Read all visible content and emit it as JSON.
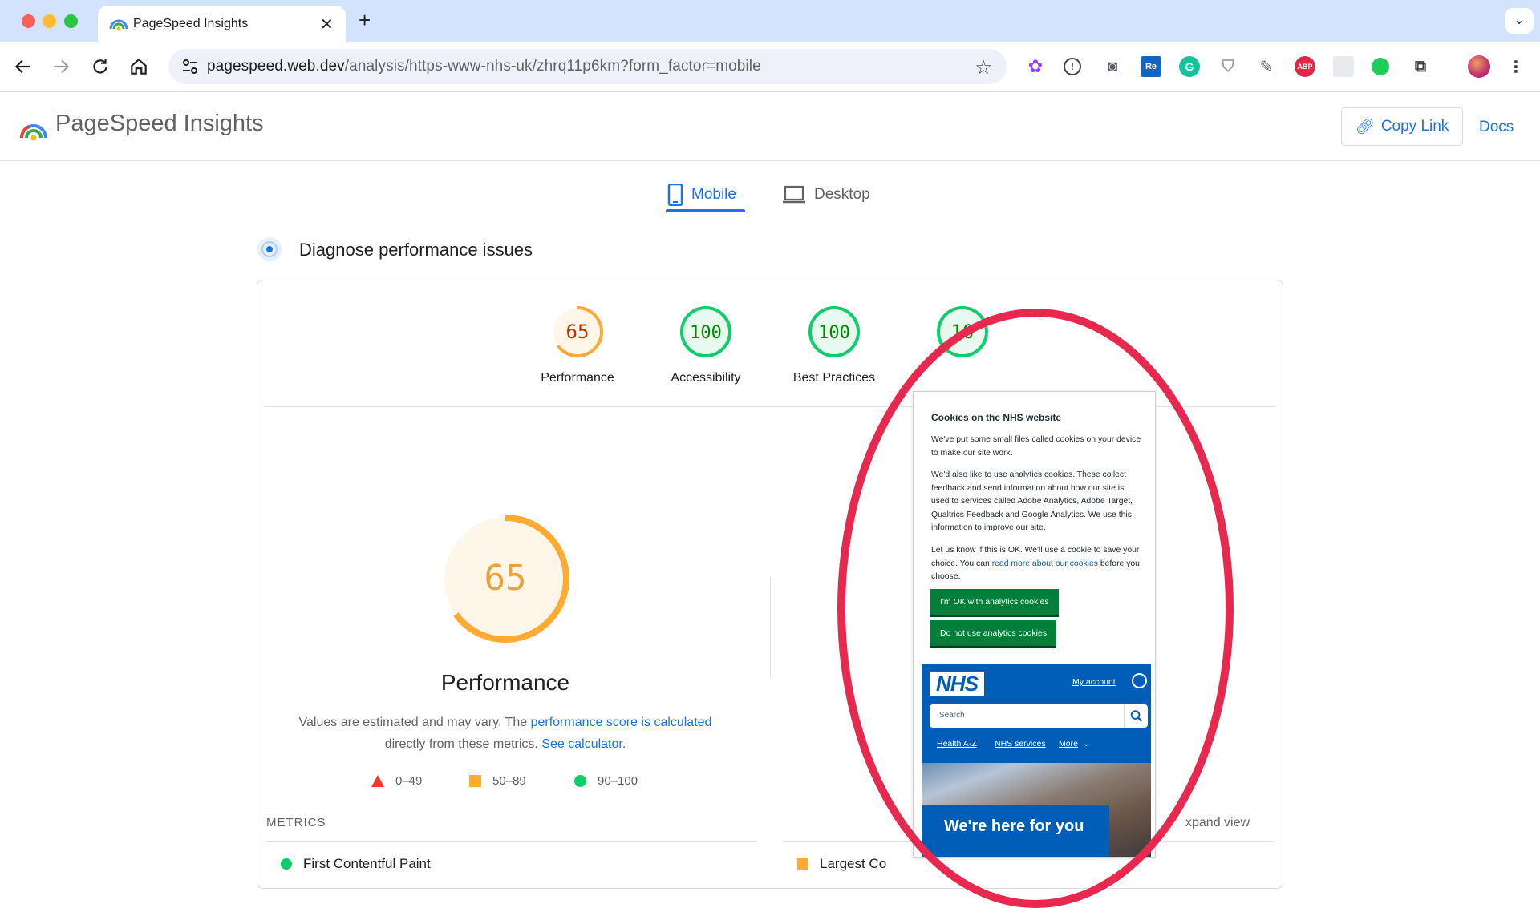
{
  "browser": {
    "tab_title": "PageSpeed Insights",
    "url_host": "pagespeed.web.dev",
    "url_path": "/analysis/https-www-nhs-uk/zhrq11p6km?form_factor=mobile",
    "extensions": [
      "puzzle-flower-icon",
      "info-icon",
      "camera-icon",
      "re-icon",
      "grammarly-icon",
      "shield-icon",
      "pin-icon",
      "abp-icon",
      "grid-icon",
      "green-dot-icon",
      "extensions-icon"
    ],
    "ext_labels": {
      "re": "Re",
      "abp": "ABP"
    }
  },
  "header": {
    "title": "PageSpeed Insights",
    "copy_link": "Copy Link",
    "docs": "Docs"
  },
  "device_tabs": {
    "mobile": "Mobile",
    "desktop": "Desktop"
  },
  "diagnose": {
    "title": "Diagnose performance issues"
  },
  "scores": [
    {
      "label": "Performance",
      "value": "65",
      "color": "#ffaa33",
      "text_color": "#c33300",
      "fraction": 0.65
    },
    {
      "label": "Accessibility",
      "value": "100",
      "color": "#0cce6b",
      "text_color": "#008800",
      "fraction": 1.0
    },
    {
      "label": "Best Practices",
      "value": "100",
      "color": "#0cce6b",
      "text_color": "#008800",
      "fraction": 1.0
    },
    {
      "label": "",
      "value": "10",
      "color": "#0cce6b",
      "text_color": "#008800",
      "fraction": 1.0
    }
  ],
  "performance": {
    "score": "65",
    "fraction": 0.65,
    "heading": "Performance",
    "desc_1": "Values are estimated and may vary. The ",
    "desc_link_1": "performance score is calculated",
    "desc_2": "directly from these metrics. ",
    "desc_link_2": "See calculator."
  },
  "legend": {
    "fail": "0–49",
    "average": "50–89",
    "pass": "90–100"
  },
  "metrics": {
    "label": "METRICS",
    "expand": "xpand view",
    "fcp": "First Contentful Paint",
    "lcp": "Largest Co"
  },
  "phone": {
    "cookie_title": "Cookies on the NHS website",
    "p1": "We've put some small files called cookies on your device to make our site work.",
    "p2": "We'd also like to use analytics cookies. These collect feedback and send information about how our site is used to services called Adobe Analytics, Adobe Target, Qualtrics Feedback and Google Analytics. We use this information to improve our site.",
    "p3_a": "Let us know if this is OK. We'll use a cookie to save your choice. You can ",
    "p3_link": "read more about our cookies",
    "p3_b": " before you choose.",
    "btn_ok": "I'm OK with analytics cookies",
    "btn_no": "Do not use analytics cookies",
    "nhs_logo": "NHS",
    "my_account": "My account",
    "search_placeholder": "Search",
    "nav": [
      "Health A-Z",
      "NHS services",
      "More"
    ],
    "hero": "We're here for you"
  },
  "colors": {
    "accent": "#1a73e8",
    "fail": "#ff3333",
    "average": "#ffaa33",
    "pass": "#0cce6b",
    "nhs_blue": "#005eb8",
    "nhs_green": "#007f3b",
    "annotation": "#e8294f"
  }
}
